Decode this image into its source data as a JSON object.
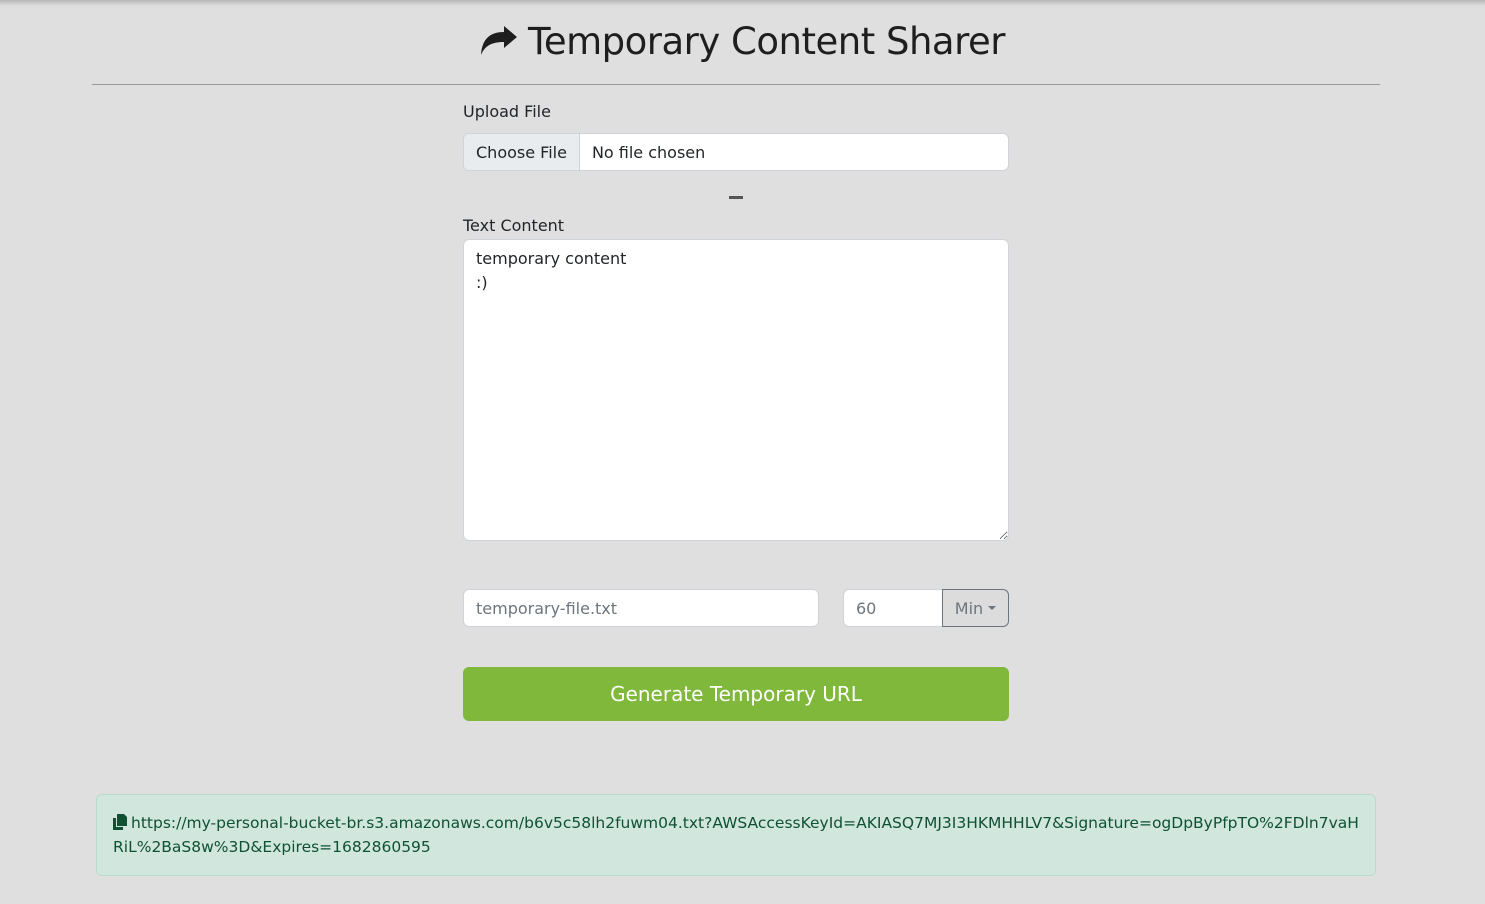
{
  "header": {
    "title": "Temporary Content Sharer",
    "icon": "share-arrow-icon"
  },
  "upload": {
    "label": "Upload File",
    "choose_button": "Choose File",
    "status": "No file chosen"
  },
  "separator": "–",
  "text_content": {
    "label": "Text Content",
    "value": "temporary content\n:)"
  },
  "filename": {
    "placeholder": "temporary-file.txt"
  },
  "duration": {
    "placeholder": "60",
    "unit": "Min"
  },
  "generate_button": "Generate Temporary URL",
  "result": {
    "icon": "copy-icon",
    "url": "https://my-personal-bucket-br.s3.amazonaws.com/b6v5c58lh2fuwm04.txt?AWSAccessKeyId=AKIASQ7MJ3I3HKMHHLV7&Signature=ogDpByPfpTO%2FDln7vaHRiL%2BaS8w%3D&Expires=1682860595"
  },
  "colors": {
    "background": "#dfdfdf",
    "accent": "#7fb83a",
    "success_bg": "#d1e7dd",
    "success_text": "#0f5132"
  }
}
